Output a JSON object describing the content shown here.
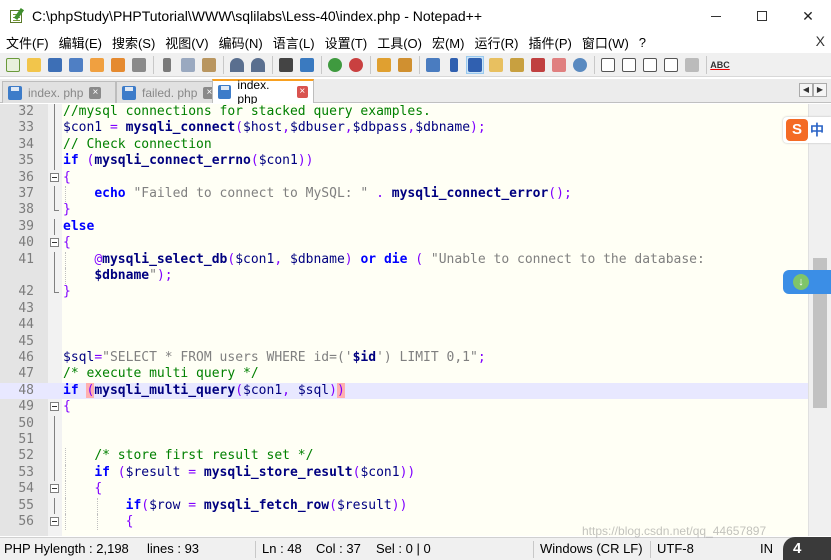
{
  "window": {
    "title": "C:\\phpStudy\\PHPTutorial\\WWW\\sqlilabs\\Less-40\\index.php - Notepad++",
    "controls": {
      "minimize": "—",
      "maximize": "☐",
      "close": "✕"
    }
  },
  "menu": {
    "items": [
      "文件(F)",
      "编辑(E)",
      "搜索(S)",
      "视图(V)",
      "编码(N)",
      "语言(L)",
      "设置(T)",
      "工具(O)",
      "宏(M)",
      "运行(R)",
      "插件(P)",
      "窗口(W)",
      "?"
    ],
    "close_label": "X"
  },
  "toolbar": {
    "icons": [
      "new-file-icon",
      "open-file-icon",
      "save-icon",
      "save-all-icon",
      "close-icon",
      "close-all-icon",
      "print-icon",
      "cut-icon",
      "copy-icon",
      "paste-icon",
      "undo-icon",
      "redo-icon",
      "find-icon",
      "replace-icon",
      "zoom-in-icon",
      "zoom-out-icon",
      "sync-vertical-icon",
      "sync-horizontal-icon",
      "word-wrap-icon",
      "show-all-chars-icon",
      "indent-guide-icon",
      "user-language-icon",
      "doc-map-icon",
      "function-list-icon",
      "folder-workspace-icon",
      "monitoring-icon",
      "record-macro-icon",
      "stop-macro-icon",
      "play-macro-icon",
      "run-macro-multiple-icon",
      "save-macro-icon",
      "spell-check-icon"
    ],
    "spell_label": "ABC"
  },
  "tabs": [
    {
      "label": "index. php",
      "active": false
    },
    {
      "label": "failed. php",
      "active": false
    },
    {
      "label": "index. php",
      "active": true
    }
  ],
  "tab_scroll": {
    "left": "◀",
    "right": "▶"
  },
  "editor": {
    "lines": [
      {
        "n": "32",
        "fold": "line",
        "tokens": [
          [
            "c-com",
            "//mysql connections for stacked query examples."
          ]
        ]
      },
      {
        "n": "33",
        "fold": "line",
        "tokens": [
          [
            "c-var",
            "$con1"
          ],
          [
            "c-plain",
            " "
          ],
          [
            "c-op",
            "="
          ],
          [
            "c-plain",
            " "
          ],
          [
            "c-fn",
            "mysqli_connect"
          ],
          [
            "c-op",
            "("
          ],
          [
            "c-var",
            "$host"
          ],
          [
            "c-op",
            ","
          ],
          [
            "c-var",
            "$dbuser"
          ],
          [
            "c-op",
            ","
          ],
          [
            "c-var",
            "$dbpass"
          ],
          [
            "c-op",
            ","
          ],
          [
            "c-var",
            "$dbname"
          ],
          [
            "c-op",
            ");"
          ]
        ]
      },
      {
        "n": "34",
        "fold": "line",
        "tokens": [
          [
            "c-com",
            "// Check connection"
          ]
        ]
      },
      {
        "n": "35",
        "fold": "line",
        "tokens": [
          [
            "c-kw",
            "if"
          ],
          [
            "c-plain",
            " "
          ],
          [
            "c-op",
            "("
          ],
          [
            "c-fn",
            "mysqli_connect_errno"
          ],
          [
            "c-op",
            "("
          ],
          [
            "c-var",
            "$con1"
          ],
          [
            "c-op",
            "))"
          ]
        ]
      },
      {
        "n": "36",
        "fold": "open",
        "tokens": [
          [
            "c-op",
            "{"
          ]
        ]
      },
      {
        "n": "37",
        "fold": "line",
        "indent": true,
        "tokens": [
          [
            "c-plain",
            "    "
          ],
          [
            "c-kw",
            "echo"
          ],
          [
            "c-plain",
            " "
          ],
          [
            "c-str",
            "\"Failed to connect to MySQL: \""
          ],
          [
            "c-plain",
            " "
          ],
          [
            "c-op",
            "."
          ],
          [
            "c-plain",
            " "
          ],
          [
            "c-fn",
            "mysqli_connect_error"
          ],
          [
            "c-op",
            "();"
          ]
        ]
      },
      {
        "n": "38",
        "fold": "end",
        "tokens": [
          [
            "c-op",
            "}"
          ]
        ]
      },
      {
        "n": "39",
        "fold": "line",
        "tokens": [
          [
            "c-kw",
            "else"
          ]
        ]
      },
      {
        "n": "40",
        "fold": "open",
        "tokens": [
          [
            "c-op",
            "{"
          ]
        ]
      },
      {
        "n": "41",
        "fold": "line",
        "indent": true,
        "tokens": [
          [
            "c-plain",
            "    "
          ],
          [
            "c-op",
            "@"
          ],
          [
            "c-fn",
            "mysqli_select_db"
          ],
          [
            "c-op",
            "("
          ],
          [
            "c-var",
            "$con1"
          ],
          [
            "c-op",
            ","
          ],
          [
            "c-plain",
            " "
          ],
          [
            "c-var",
            "$dbname"
          ],
          [
            "c-op",
            ")"
          ],
          [
            "c-plain",
            " "
          ],
          [
            "c-kw",
            "or"
          ],
          [
            "c-plain",
            " "
          ],
          [
            "c-kw",
            "die"
          ],
          [
            "c-plain",
            " "
          ],
          [
            "c-op",
            "("
          ],
          [
            "c-plain",
            " "
          ],
          [
            "c-str",
            "\"Unable to connect to the database:"
          ]
        ]
      },
      {
        "n": "",
        "fold": "line",
        "indent": true,
        "tokens": [
          [
            "c-plain",
            "    "
          ],
          [
            "c-strvar",
            "$dbname"
          ],
          [
            "c-str",
            "\""
          ],
          [
            "c-op",
            ");"
          ]
        ]
      },
      {
        "n": "42",
        "fold": "end",
        "tokens": [
          [
            "c-op",
            "}"
          ]
        ]
      },
      {
        "n": "43",
        "fold": "none",
        "tokens": []
      },
      {
        "n": "44",
        "fold": "none",
        "tokens": []
      },
      {
        "n": "45",
        "fold": "none",
        "tokens": []
      },
      {
        "n": "46",
        "fold": "none",
        "tokens": [
          [
            "c-var",
            "$sql"
          ],
          [
            "c-op",
            "="
          ],
          [
            "c-str",
            "\"SELECT * FROM users WHERE id=('"
          ],
          [
            "c-strvar",
            "$id"
          ],
          [
            "c-str",
            "') LIMIT 0,1\""
          ],
          [
            "c-op",
            ";"
          ]
        ]
      },
      {
        "n": "47",
        "fold": "none",
        "tokens": [
          [
            "c-com",
            "/* execute multi query */"
          ]
        ]
      },
      {
        "n": "48",
        "fold": "none",
        "current": true,
        "tokens": [
          [
            "c-kw",
            "if"
          ],
          [
            "c-plain",
            " "
          ],
          [
            "c-op c-hl",
            "("
          ],
          [
            "c-fn",
            "mysqli_multi_query"
          ],
          [
            "c-op",
            "("
          ],
          [
            "c-var",
            "$con1"
          ],
          [
            "c-op",
            ","
          ],
          [
            "c-plain",
            " "
          ],
          [
            "c-var",
            "$sql"
          ],
          [
            "c-op",
            ")"
          ],
          [
            "c-op c-hl",
            ")"
          ]
        ]
      },
      {
        "n": "49",
        "fold": "open",
        "tokens": [
          [
            "c-op",
            "{"
          ]
        ]
      },
      {
        "n": "50",
        "fold": "line",
        "tokens": []
      },
      {
        "n": "51",
        "fold": "line",
        "tokens": []
      },
      {
        "n": "52",
        "fold": "line",
        "indent": true,
        "tokens": [
          [
            "c-plain",
            "    "
          ],
          [
            "c-com",
            "/* store first result set */"
          ]
        ]
      },
      {
        "n": "53",
        "fold": "line",
        "indent": true,
        "tokens": [
          [
            "c-plain",
            "    "
          ],
          [
            "c-kw",
            "if"
          ],
          [
            "c-plain",
            " "
          ],
          [
            "c-op",
            "("
          ],
          [
            "c-var",
            "$result"
          ],
          [
            "c-plain",
            " "
          ],
          [
            "c-op",
            "="
          ],
          [
            "c-plain",
            " "
          ],
          [
            "c-fn",
            "mysqli_store_result"
          ],
          [
            "c-op",
            "("
          ],
          [
            "c-var",
            "$con1"
          ],
          [
            "c-op",
            "))"
          ]
        ]
      },
      {
        "n": "54",
        "fold": "open",
        "indent": true,
        "tokens": [
          [
            "c-plain",
            "    "
          ],
          [
            "c-op",
            "{"
          ]
        ]
      },
      {
        "n": "55",
        "fold": "line",
        "indent2": true,
        "tokens": [
          [
            "c-plain",
            "        "
          ],
          [
            "c-kw",
            "if"
          ],
          [
            "c-op",
            "("
          ],
          [
            "c-var",
            "$row"
          ],
          [
            "c-plain",
            " "
          ],
          [
            "c-op",
            "="
          ],
          [
            "c-plain",
            " "
          ],
          [
            "c-fn",
            "mysqli_fetch_row"
          ],
          [
            "c-op",
            "("
          ],
          [
            "c-var",
            "$result"
          ],
          [
            "c-op",
            "))"
          ]
        ]
      },
      {
        "n": "56",
        "fold": "open",
        "indent2": true,
        "tokens": [
          [
            "c-plain",
            "        "
          ],
          [
            "c-op",
            "{"
          ]
        ]
      }
    ]
  },
  "overlays": {
    "sogou_logo_char": "S",
    "sogou_lang": "中",
    "down_arrow": "↓"
  },
  "status": {
    "file_type": "PHP Hy",
    "length": "length : 2,198",
    "lines": "lines : 93",
    "ln": "Ln : 48",
    "col": "Col : 37",
    "sel": "Sel : 0 | 0",
    "eol": "Windows (CR LF)",
    "encoding": "UTF-8",
    "ins": "IN",
    "corner_badge": "4"
  },
  "watermark": "https://blog.csdn.net/qq_44657897"
}
